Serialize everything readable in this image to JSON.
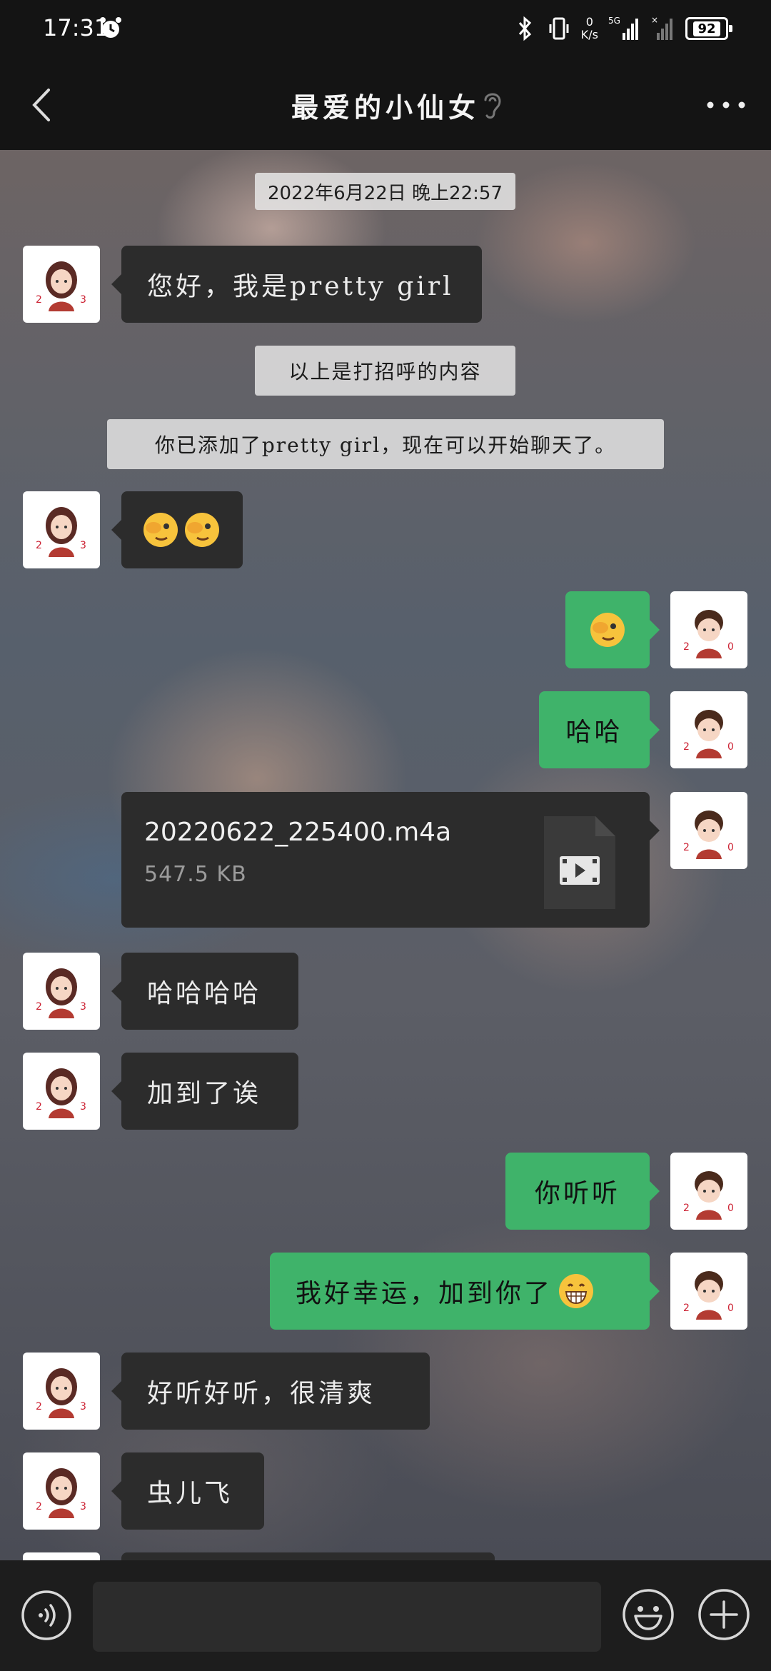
{
  "status_bar": {
    "time": "17:31",
    "net_speed_value": "0",
    "net_speed_unit": "K/s",
    "network_label": "5G",
    "battery": "92"
  },
  "nav": {
    "title": "最爱的小仙女"
  },
  "chat": {
    "timestamp": "2022年6月22日 晚上22:57",
    "notices": [
      "以上是打招呼的内容",
      "你已添加了pretty  girl，现在可以开始聊天了。"
    ],
    "messages": [
      {
        "side": "left",
        "text": "您好，我是pretty  girl"
      },
      {
        "side": "left",
        "emoji": [
          "face-with-hand-over-eye",
          "face-with-hand-over-eye"
        ]
      },
      {
        "side": "right",
        "emoji": [
          "face-with-hand-over-eye"
        ]
      },
      {
        "side": "right",
        "text": "哈哈"
      },
      {
        "side": "right",
        "file": {
          "name": "20220622_225400.m4a",
          "size": "547.5 KB",
          "icon": "video-file-icon"
        }
      },
      {
        "side": "left",
        "text": "哈哈哈哈"
      },
      {
        "side": "left",
        "text": "加到了诶"
      },
      {
        "side": "right",
        "text": "你听听"
      },
      {
        "side": "right",
        "text": "我好幸运，加到你了",
        "trailing_emoji": "grinning-face"
      },
      {
        "side": "left",
        "text": "好听好听，很清爽"
      },
      {
        "side": "left",
        "text": "虫儿飞"
      }
    ]
  },
  "avatars": {
    "left_number": [
      "2",
      "3"
    ],
    "right_number": [
      "2",
      "0"
    ]
  },
  "input_bar": {
    "placeholder": "",
    "icons": [
      "voice-icon",
      "emoji-icon",
      "plus-icon"
    ]
  },
  "colors": {
    "accent_green": "#3fb36a",
    "bubble_dark": "#2c2c2c",
    "bar_bg": "#141414"
  }
}
